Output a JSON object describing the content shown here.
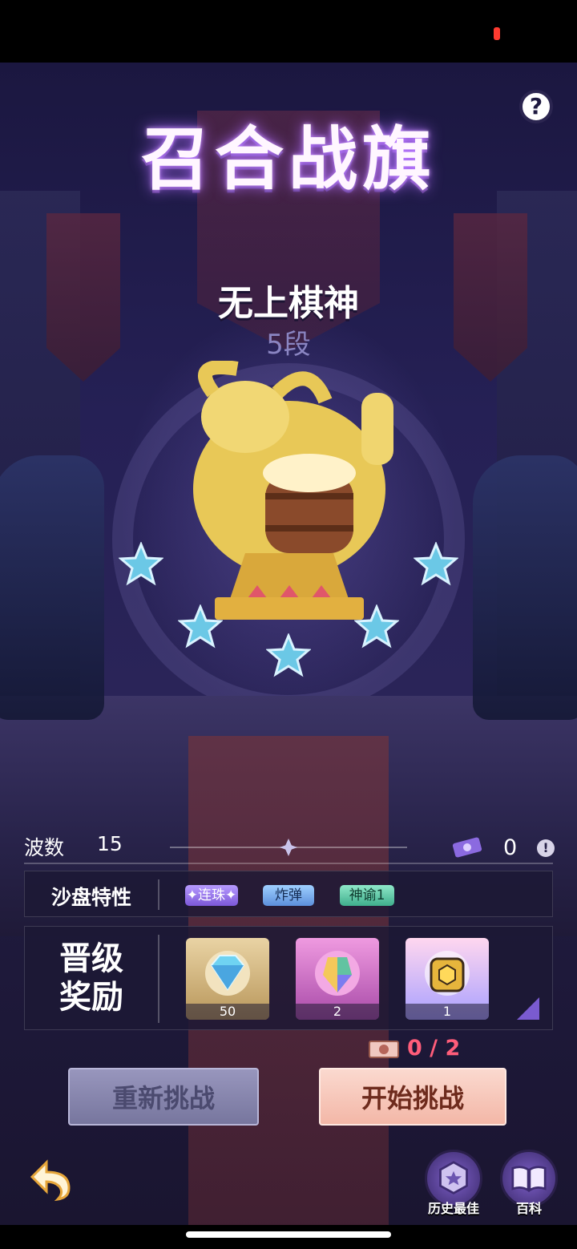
{
  "header": {
    "title": "召合战旗",
    "help_label": "?"
  },
  "rank": {
    "name": "无上棋神",
    "level": "5段",
    "stars": 5
  },
  "wave": {
    "label": "波数",
    "value": "15",
    "ticket_count": "0",
    "info_label": "!"
  },
  "traits": {
    "label": "沙盘特性",
    "tags": [
      "✦连珠✦",
      "炸弹",
      "神谕1"
    ]
  },
  "rewards": {
    "label": "晋级\n奖励",
    "items": [
      {
        "icon": "diamond-icon",
        "count": "50"
      },
      {
        "icon": "rainbow-crystal-icon",
        "count": "2"
      },
      {
        "icon": "gold-chest-icon",
        "count": "1"
      }
    ]
  },
  "attempts": {
    "text": "0 / 2"
  },
  "buttons": {
    "retry": "重新挑战",
    "start": "开始挑战"
  },
  "footer": {
    "best_label": "历史最佳",
    "wiki_label": "百科"
  }
}
